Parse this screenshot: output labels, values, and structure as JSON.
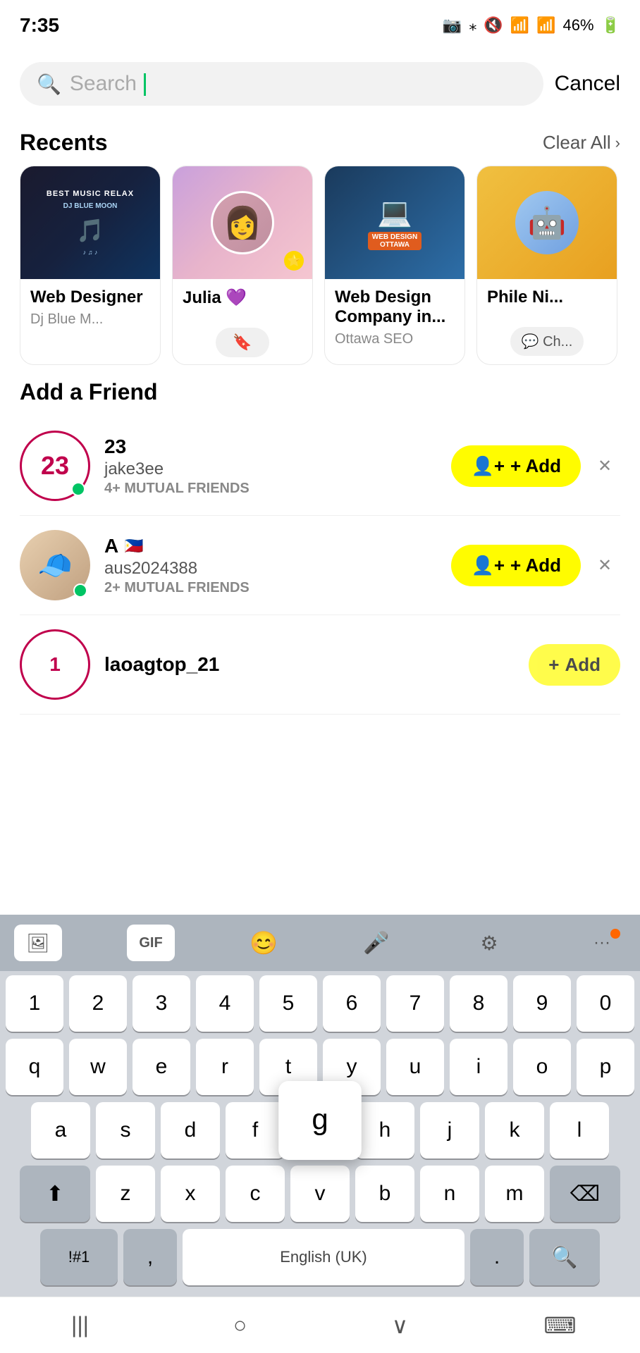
{
  "status": {
    "time": "7:35",
    "battery": "46%"
  },
  "search": {
    "placeholder": "Search",
    "cancel_label": "Cancel"
  },
  "recents": {
    "title": "Recents",
    "clear_all_label": "Clear All",
    "items": [
      {
        "id": "web-designer",
        "name": "Web Designer",
        "sub": "Dj Blue M...",
        "type": "music"
      },
      {
        "id": "julia",
        "name": "Julia 💜",
        "sub": "",
        "type": "profile"
      },
      {
        "id": "web-design-company",
        "name": "Web Design Company in...",
        "sub": "Ottawa SEO",
        "type": "webdesign"
      },
      {
        "id": "phile-ni",
        "name": "Phile Ni...",
        "sub": "Ch...",
        "type": "character"
      }
    ]
  },
  "add_friend": {
    "title": "Add a Friend",
    "items": [
      {
        "id": "jake3ee",
        "display_number": "23",
        "username": "jake3ee",
        "mutual": "4+ MUTUAL FRIENDS",
        "flag": "",
        "online": true
      },
      {
        "id": "aus2024388",
        "display_letter": "A",
        "flag": "🇵🇭",
        "username": "aus2024388",
        "mutual": "2+ MUTUAL FRIENDS",
        "online": true
      },
      {
        "id": "laoagtop_21",
        "display_number": "",
        "username": "laoagtop_21",
        "mutual": "",
        "online": false
      }
    ],
    "add_label": "+ Add",
    "add_icon": "+"
  },
  "keyboard": {
    "toolbar": {
      "sticker_icon": "🖼",
      "gif_label": "GIF",
      "emoji_icon": "😊",
      "mic_icon": "🎤",
      "gear_icon": "⚙",
      "more_icon": "···"
    },
    "rows": {
      "numbers": [
        "1",
        "2",
        "3",
        "4",
        "5",
        "6",
        "7",
        "8",
        "9",
        "0"
      ],
      "row1": [
        "q",
        "w",
        "e",
        "r",
        "t",
        "y",
        "u",
        "i",
        "o",
        "p"
      ],
      "row2": [
        "a",
        "s",
        "d",
        "f",
        "g",
        "h",
        "j",
        "k",
        "l"
      ],
      "row3": [
        "z",
        "x",
        "c",
        "v",
        "b",
        "n",
        "m"
      ],
      "bottom": {
        "special": "!#1",
        "comma": ",",
        "space_label": "English (UK)",
        "period": ".",
        "search": "🔍"
      }
    },
    "popup_key": "g"
  },
  "nav": {
    "back_icon": "|||",
    "home_icon": "○",
    "recent_icon": "∨",
    "keyboard_icon": "⌨"
  }
}
